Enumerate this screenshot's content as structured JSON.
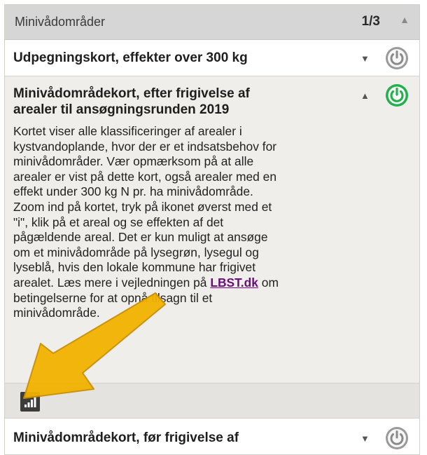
{
  "panel": {
    "title": "Minivådområder",
    "pager": "1/3"
  },
  "layers": [
    {
      "title": "Udpegningskort, effekter over 300 kg",
      "state": "collapsed",
      "power": "off"
    },
    {
      "title_line1": "Minivådområdekort, efter frigivelse af",
      "title_line2": "arealer til ansøgningsrunden 2019",
      "state": "expanded",
      "power": "on",
      "description_before_link": "Kortet viser alle klassificeringer af arealer i kystvandoplande, hvor der er et indsatsbehov for minivådområder. Vær opmærksom på at alle arealer er vist på dette kort, også arealer med en effekt under 300 kg N pr. ha minivådområde. Zoom ind på kortet, tryk på ikonet øverst med et \"i\", klik på et areal og se effekten af det pågældende areal. Det er kun muligt at ansøge om et minivådområde på lysegrøn, lysegul og lyseblå, hvis den lokale kommune har frigivet arealet. Læs mere i vejledningen på ",
      "description_link": "LBST.dk",
      "description_after_link": " om betingelserne for at opnå tilsagn til et minivådområde."
    },
    {
      "title": "Minivådområdekort, før frigivelse af",
      "state": "collapsed",
      "power": "off"
    }
  ],
  "icons": {
    "collapse": "chevron-up-icon",
    "expand": "chevron-down-icon",
    "power": "power-icon",
    "legend": "signal-bars-icon",
    "callout": "arrow-icon"
  },
  "colors": {
    "power_on": "#22b14c",
    "power_off": "#9a9a9a",
    "link": "#6a0d7a",
    "arrow": "#f2b200"
  }
}
